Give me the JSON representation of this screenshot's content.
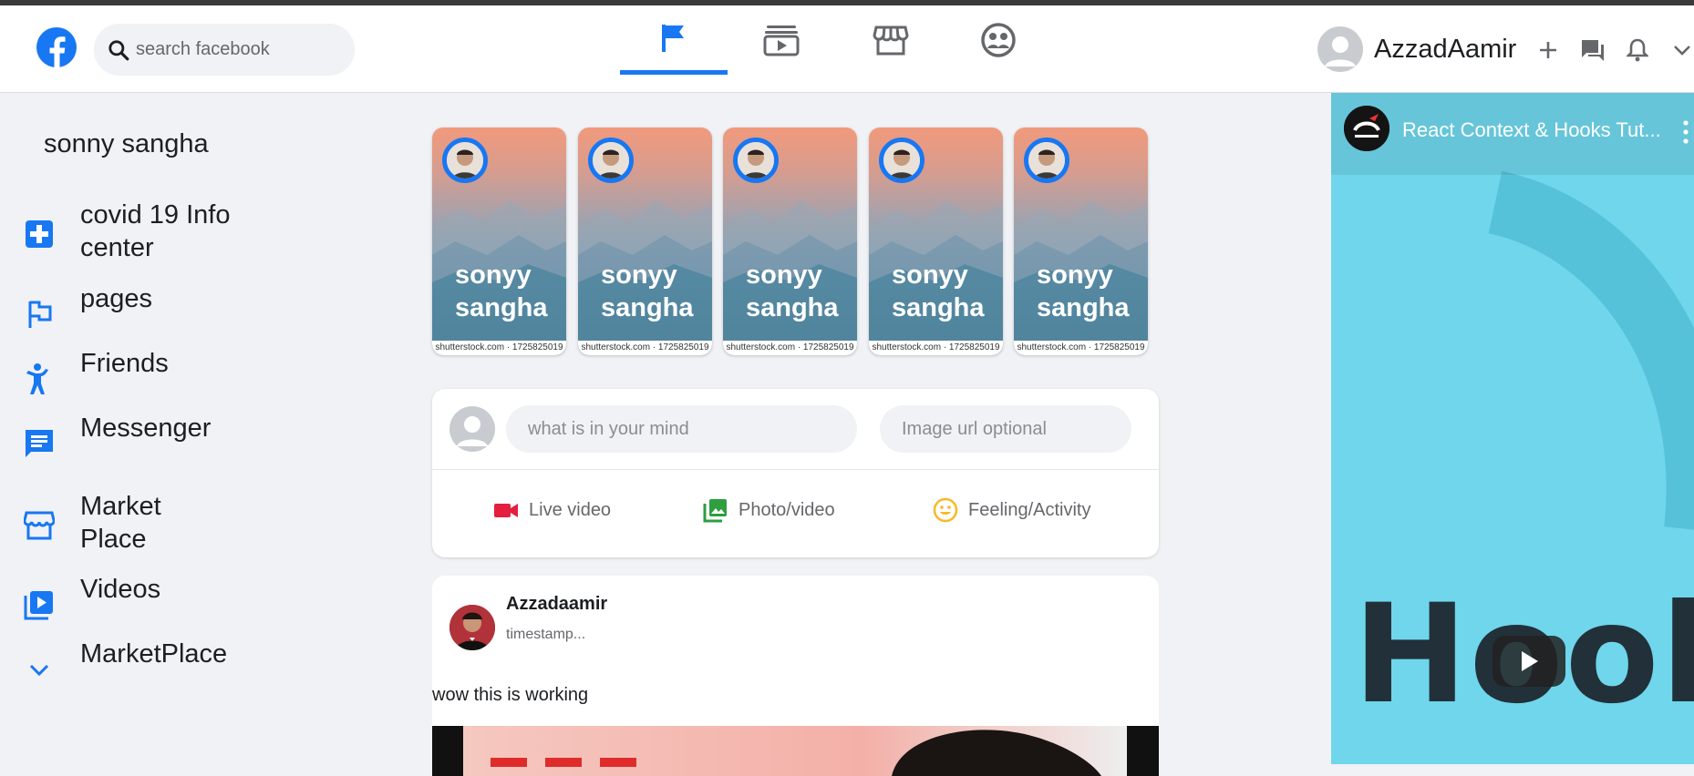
{
  "header": {
    "search_placeholder": "search facebook",
    "username": "AzzadAamir",
    "nav_tabs": [
      {
        "icon": "flag-icon",
        "active": true
      },
      {
        "icon": "video-icon",
        "active": false
      },
      {
        "icon": "store-icon",
        "active": false
      },
      {
        "icon": "group-icon",
        "active": false
      }
    ],
    "right_icons": [
      "add-icon",
      "messenger-icon",
      "notifications-icon",
      "chevron-down-icon"
    ]
  },
  "sidebar": {
    "user": "sonny sangha",
    "items": [
      {
        "label": "covid 19 Info center",
        "line1": "covid 19 Info",
        "line2": "center",
        "icon": "plus-icon"
      },
      {
        "label": "pages",
        "icon": "flag-icon"
      },
      {
        "label": "Friends",
        "icon": "people-icon"
      },
      {
        "label": "Messenger",
        "icon": "chat-icon"
      },
      {
        "label": "Market Place",
        "line1": "Market",
        "line2": "Place",
        "icon": "store-icon"
      },
      {
        "label": "Videos",
        "icon": "video-library-icon"
      },
      {
        "label": "MarketPlace",
        "icon": "chevron-down-icon"
      }
    ]
  },
  "stories": [
    {
      "line1": "sonyy",
      "line2": "sangha",
      "credit": "shutterstock.com · 1725825019"
    },
    {
      "line1": "sonyy",
      "line2": "sangha",
      "credit": "shutterstock.com · 1725825019"
    },
    {
      "line1": "sonyy",
      "line2": "sangha",
      "credit": "shutterstock.com · 1725825019"
    },
    {
      "line1": "sonyy",
      "line2": "sangha",
      "credit": "shutterstock.com · 1725825019"
    },
    {
      "line1": "sonyy",
      "line2": "sangha",
      "credit": "shutterstock.com · 1725825019"
    }
  ],
  "composer": {
    "message_placeholder": "what is in your mind",
    "image_placeholder": "Image url optional",
    "actions": [
      {
        "label": "Live video",
        "icon": "videocam-icon",
        "color": "#f02849"
      },
      {
        "label": "Photo/video",
        "icon": "photo-library-icon",
        "color": "#45bd62"
      },
      {
        "label": "Feeling/Activity",
        "icon": "emoji-icon",
        "color": "#f7b928"
      }
    ]
  },
  "post": {
    "author": "Azzadaamir",
    "timestamp": "timestamp...",
    "text": "wow this is working"
  },
  "video": {
    "title": "React Context & Hooks Tut...",
    "overlay_text": "Hook"
  },
  "colors": {
    "accent": "#1877f2",
    "background": "#f0f2f5"
  }
}
